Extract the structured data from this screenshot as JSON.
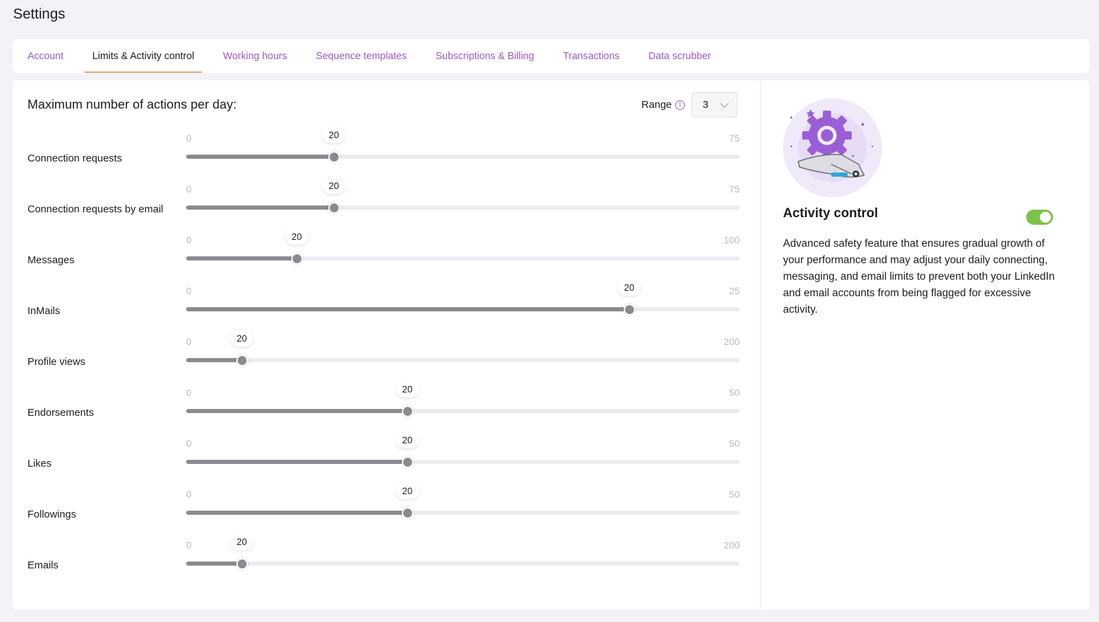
{
  "page": {
    "title": "Settings"
  },
  "tabs": [
    {
      "label": "Account",
      "active": false
    },
    {
      "label": "Limits & Activity control",
      "active": true
    },
    {
      "label": "Working hours",
      "active": false
    },
    {
      "label": "Sequence templates",
      "active": false
    },
    {
      "label": "Subscriptions & Billing",
      "active": false
    },
    {
      "label": "Transactions",
      "active": false
    },
    {
      "label": "Data scrubber",
      "active": false
    }
  ],
  "limits": {
    "title": "Maximum number of actions per day:",
    "range_label": "Range",
    "range_value": "3",
    "sliders": [
      {
        "label": "Connection requests",
        "min": 0,
        "max": 75,
        "value": 20
      },
      {
        "label": "Connection requests by email",
        "min": 0,
        "max": 75,
        "value": 20
      },
      {
        "label": "Messages",
        "min": 0,
        "max": 100,
        "value": 20
      },
      {
        "label": "InMails",
        "min": 0,
        "max": 25,
        "value": 20
      },
      {
        "label": "Profile views",
        "min": 0,
        "max": 200,
        "value": 20
      },
      {
        "label": "Endorsements",
        "min": 0,
        "max": 50,
        "value": 20
      },
      {
        "label": "Likes",
        "min": 0,
        "max": 50,
        "value": 20
      },
      {
        "label": "Followings",
        "min": 0,
        "max": 50,
        "value": 20
      },
      {
        "label": "Emails",
        "min": 0,
        "max": 200,
        "value": 20
      }
    ]
  },
  "activity_control": {
    "title": "Activity control",
    "enabled": true,
    "description": "Advanced safety feature that ensures gradual growth of your performance and may adjust your daily connecting, messaging, and email limits to prevent both your LinkedIn and email accounts from being flagged for excessive activity."
  },
  "colors": {
    "accent_purple": "#9b59c9",
    "active_tab_underline": "#f0a070",
    "toggle_on": "#7cc24a",
    "slider_fill": "#8a8a8f"
  }
}
